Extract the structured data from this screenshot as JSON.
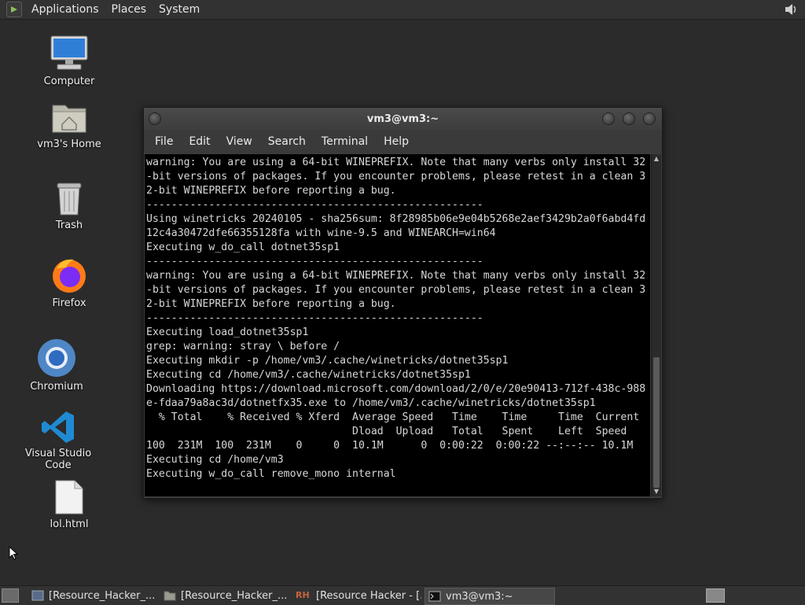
{
  "top_panel": {
    "menus": [
      "Applications",
      "Places",
      "System"
    ]
  },
  "desktop_icons": [
    {
      "label": "Computer"
    },
    {
      "label": "vm3's Home"
    },
    {
      "label": "Trash"
    },
    {
      "label": "Firefox"
    },
    {
      "label": "Chromium"
    },
    {
      "label": "Visual Studio Code"
    },
    {
      "label": "lol.html"
    }
  ],
  "window": {
    "title": "vm3@vm3:~",
    "menu": [
      "File",
      "Edit",
      "View",
      "Search",
      "Terminal",
      "Help"
    ]
  },
  "terminal_lines": [
    "warning: You are using a 64-bit WINEPREFIX. Note that many verbs only install 32",
    "-bit versions of packages. If you encounter problems, please retest in a clean 3",
    "2-bit WINEPREFIX before reporting a bug.",
    "------------------------------------------------------",
    "Using winetricks 20240105 - sha256sum: 8f28985b06e9e04b5268e2aef3429b2a0f6abd4fd",
    "12c4a30472dfe66355128fa with wine-9.5 and WINEARCH=win64",
    "Executing w_do_call dotnet35sp1",
    "------------------------------------------------------",
    "warning: You are using a 64-bit WINEPREFIX. Note that many verbs only install 32",
    "-bit versions of packages. If you encounter problems, please retest in a clean 3",
    "2-bit WINEPREFIX before reporting a bug.",
    "------------------------------------------------------",
    "Executing load_dotnet35sp1",
    "grep: warning: stray \\ before /",
    "Executing mkdir -p /home/vm3/.cache/winetricks/dotnet35sp1",
    "Executing cd /home/vm3/.cache/winetricks/dotnet35sp1",
    "Downloading https://download.microsoft.com/download/2/0/e/20e90413-712f-438c-988",
    "e-fdaa79a8ac3d/dotnetfx35.exe to /home/vm3/.cache/winetricks/dotnet35sp1",
    "  % Total    % Received % Xferd  Average Speed   Time    Time     Time  Current",
    "                                 Dload  Upload   Total   Spent    Left  Speed",
    "100  231M  100  231M    0     0  10.1M      0  0:00:22  0:00:22 --:--:-- 10.1M",
    "Executing cd /home/vm3",
    "Executing w_do_call remove_mono internal"
  ],
  "taskbar": {
    "tasks": [
      {
        "label": "[Resource_Hacker_..."
      },
      {
        "label": "[Resource_Hacker_..."
      },
      {
        "label": "[Resource Hacker - [..."
      },
      {
        "label": "vm3@vm3:~",
        "active": true
      }
    ],
    "rh_icon_text": "RH"
  },
  "colors": {
    "desktop": "#2b2b2b",
    "panel": "#323232",
    "terminal_bg": "#000000",
    "terminal_fg": "#d8d8d8"
  }
}
